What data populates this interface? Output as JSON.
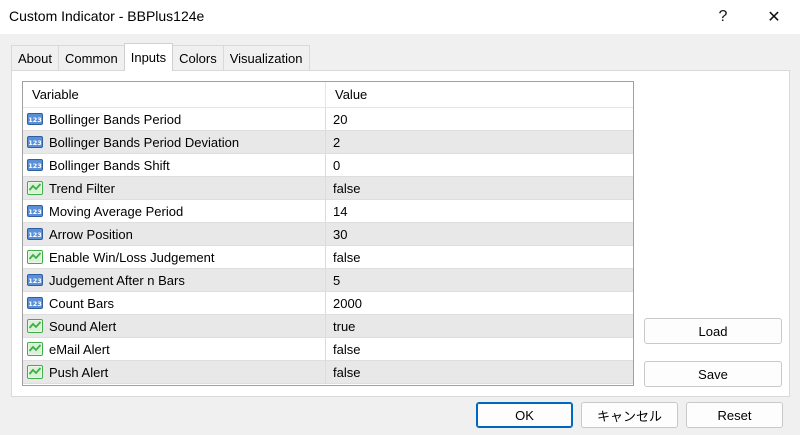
{
  "window": {
    "title": "Custom Indicator - BBPlus124e",
    "help_glyph": "?",
    "close_glyph": "✕"
  },
  "tabs": [
    {
      "label": "About"
    },
    {
      "label": "Common"
    },
    {
      "label": "Inputs",
      "active": true
    },
    {
      "label": "Colors"
    },
    {
      "label": "Visualization"
    }
  ],
  "table": {
    "headers": {
      "variable": "Variable",
      "value": "Value"
    },
    "rows": [
      {
        "icon": "number-icon",
        "variable": "Bollinger Bands Period",
        "value": "20"
      },
      {
        "icon": "number-icon",
        "variable": "Bollinger Bands Period Deviation",
        "value": "2"
      },
      {
        "icon": "number-icon",
        "variable": "Bollinger Bands Shift",
        "value": "0"
      },
      {
        "icon": "boolean-icon",
        "variable": "Trend Filter",
        "value": "false"
      },
      {
        "icon": "number-icon",
        "variable": "Moving Average Period",
        "value": "14"
      },
      {
        "icon": "number-icon",
        "variable": "Arrow Position",
        "value": "30"
      },
      {
        "icon": "boolean-icon",
        "variable": "Enable Win/Loss Judgement",
        "value": "false"
      },
      {
        "icon": "number-icon",
        "variable": "Judgement After n Bars",
        "value": "5"
      },
      {
        "icon": "number-icon",
        "variable": "Count Bars",
        "value": "2000"
      },
      {
        "icon": "boolean-icon",
        "variable": "Sound Alert",
        "value": "true"
      },
      {
        "icon": "boolean-icon",
        "variable": "eMail Alert",
        "value": "false"
      },
      {
        "icon": "boolean-icon",
        "variable": "Push Alert",
        "value": "false"
      }
    ]
  },
  "side_buttons": {
    "load": "Load",
    "save": "Save"
  },
  "footer_buttons": {
    "ok": "OK",
    "cancel": "キャンセル",
    "reset": "Reset"
  },
  "colors": {
    "accent": "#0067c0",
    "number_icon_fill": "#5b8fd6",
    "boolean_icon_fill": "#3fae49"
  }
}
